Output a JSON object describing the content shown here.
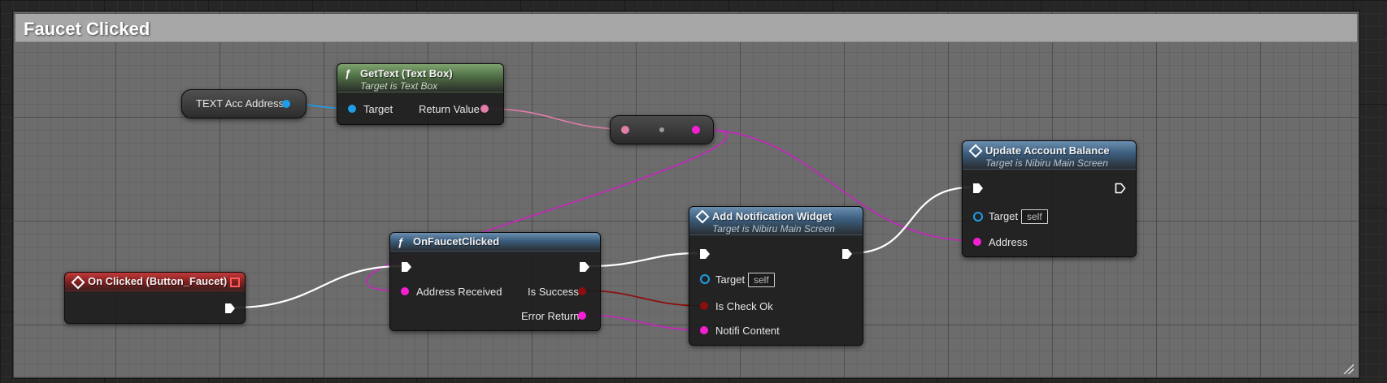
{
  "comment": {
    "title": "Faucet Clicked"
  },
  "nodes": {
    "text_acc_address": {
      "label": "TEXT Acc Address"
    },
    "get_text": {
      "title": "GetText (Text Box)",
      "subtitle": "Target is Text Box",
      "pins": {
        "target": "Target",
        "return_value": "Return Value"
      }
    },
    "on_clicked": {
      "title": "On Clicked (Button_Faucet)"
    },
    "on_faucet_clicked": {
      "title": "OnFaucetClicked",
      "pins": {
        "address_received": "Address Received",
        "is_success": "Is Success",
        "error_return": "Error Return"
      }
    },
    "add_notification_widget": {
      "title": "Add Notification Widget",
      "subtitle": "Target is Nibiru Main Screen",
      "pins": {
        "target": "Target",
        "target_value": "self",
        "is_check_ok": "Is Check Ok",
        "notifi_content": "Notifi Content"
      }
    },
    "update_account_balance": {
      "title": "Update Account Balance",
      "subtitle": "Target is Nibiru Main Screen",
      "pins": {
        "target": "Target",
        "target_value": "self",
        "address": "Address"
      }
    }
  },
  "colors": {
    "exec": "#ffffff",
    "object_pin": "#1e9ee8",
    "string_pin": "#f41fd2",
    "text_pin": "#e27ca8",
    "bool_pin": "#8c0f0f",
    "event_header": "#9a2727",
    "function_header": "#3b5d7d",
    "pure_function_header": "#4f6e45",
    "comment_header": "#a7a7a7"
  }
}
